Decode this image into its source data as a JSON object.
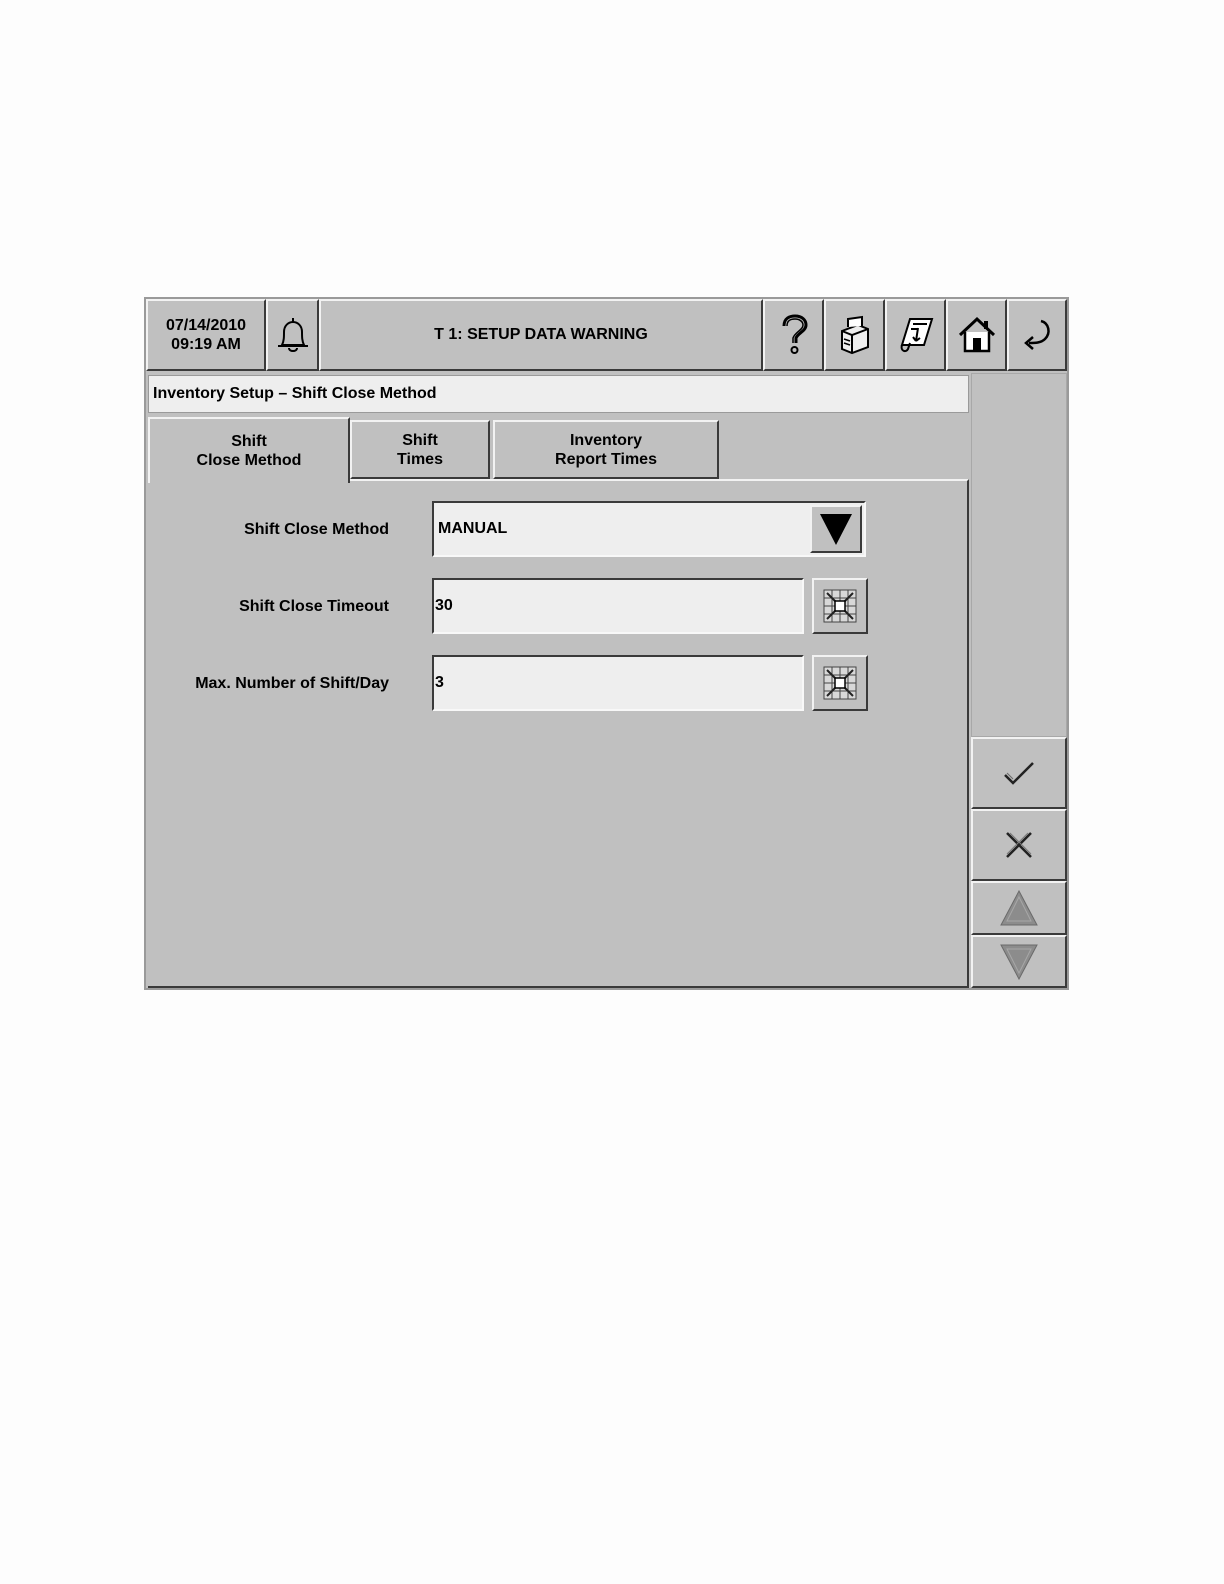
{
  "header": {
    "date": "07/14/2010",
    "time": "09:19 AM",
    "status_message": "T 1: SETUP DATA WARNING",
    "icons": [
      "bell-icon",
      "help-icon",
      "printer-icon",
      "report-icon",
      "home-icon",
      "back-icon"
    ]
  },
  "page": {
    "title": "Inventory Setup – Shift Close Method"
  },
  "tabs": [
    {
      "line1": "Shift",
      "line2": "Close Method",
      "active": true
    },
    {
      "line1": "Shift",
      "line2": "Times",
      "active": false
    },
    {
      "line1": "Inventory",
      "line2": "Report Times",
      "active": false
    }
  ],
  "form": {
    "shift_close_method": {
      "label": "Shift Close Method",
      "value": "MANUAL"
    },
    "shift_close_timeout": {
      "label": "Shift Close Timeout",
      "value": "30"
    },
    "max_shifts_per_day": {
      "label": "Max. Number of Shift/Day",
      "value": "3"
    }
  },
  "side_buttons": [
    "accept-icon",
    "cancel-icon",
    "scroll-up-icon",
    "scroll-down-icon"
  ],
  "colors": {
    "panel": "#c0c0c0",
    "field": "#eeeeee",
    "background": "#fdfdfd"
  }
}
